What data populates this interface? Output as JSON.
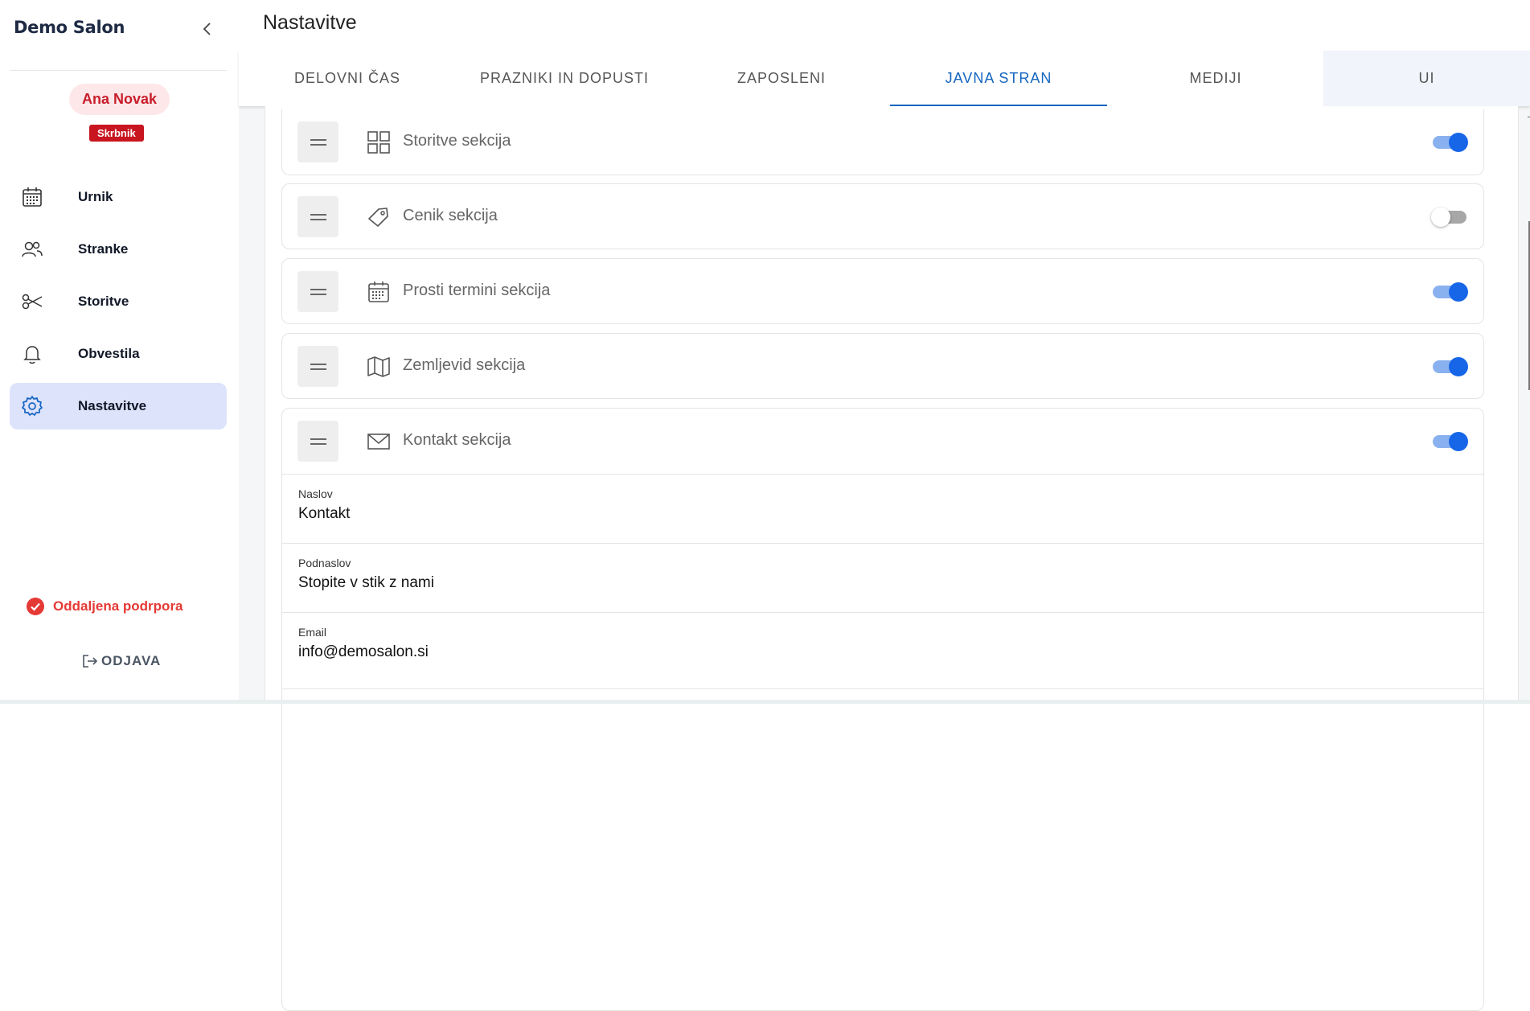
{
  "sidebar": {
    "brand": "Demo Salon",
    "user_name": "Ana Novak",
    "user_role": "Skrbnik",
    "items": [
      {
        "label": "Urnik",
        "icon": "calendar-icon"
      },
      {
        "label": "Stranke",
        "icon": "users-icon"
      },
      {
        "label": "Storitve",
        "icon": "scissors-icon"
      },
      {
        "label": "Obvestila",
        "icon": "bell-icon"
      },
      {
        "label": "Nastavitve",
        "icon": "gear-icon",
        "active": true
      }
    ],
    "support_label": "Oddaljena podrpora",
    "logout_label": "ODJAVA"
  },
  "header": {
    "title": "Nastavitve"
  },
  "tabs": [
    {
      "label": "DELOVNI ČAS"
    },
    {
      "label": "PRAZNIKI IN DOPUSTI"
    },
    {
      "label": "ZAPOSLENI"
    },
    {
      "label": "JAVNA STRAN",
      "active": true
    },
    {
      "label": "MEDIJI"
    },
    {
      "label": "UI"
    }
  ],
  "sections": [
    {
      "label": "Storitve sekcija",
      "icon": "grid-icon",
      "enabled": true
    },
    {
      "label": "Cenik sekcija",
      "icon": "tag-icon",
      "enabled": false
    },
    {
      "label": "Prosti termini sekcija",
      "icon": "calendar-icon",
      "enabled": true
    },
    {
      "label": "Zemljevid sekcija",
      "icon": "map-icon",
      "enabled": true
    },
    {
      "label": "Kontakt sekcija",
      "icon": "mail-icon",
      "enabled": true
    }
  ],
  "contact_fields": [
    {
      "label": "Naslov",
      "value": "Kontakt"
    },
    {
      "label": "Podnaslov",
      "value": "Stopite v stik z nami"
    },
    {
      "label": "Email",
      "value": "info@demosalon.si"
    }
  ],
  "colors": {
    "accent": "#1565c0",
    "toggle_on": "#1766e8",
    "active_nav": "#dde3fb",
    "user_pill": "#fde7e9",
    "role_badge": "#c8151f",
    "support": "#e53935"
  }
}
